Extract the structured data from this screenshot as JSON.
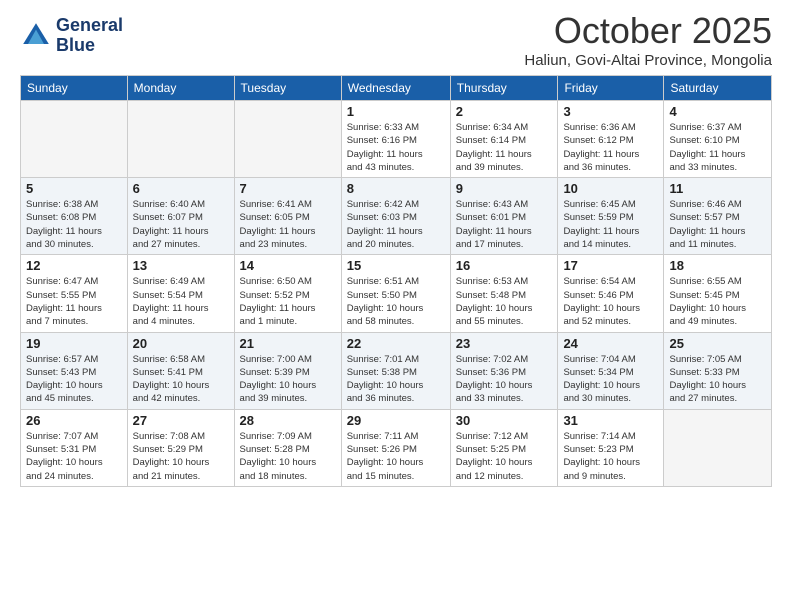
{
  "header": {
    "logo_line1": "General",
    "logo_line2": "Blue",
    "month": "October 2025",
    "location": "Haliun, Govi-Altai Province, Mongolia"
  },
  "weekdays": [
    "Sunday",
    "Monday",
    "Tuesday",
    "Wednesday",
    "Thursday",
    "Friday",
    "Saturday"
  ],
  "weeks": [
    [
      {
        "day": null,
        "info": null
      },
      {
        "day": null,
        "info": null
      },
      {
        "day": null,
        "info": null
      },
      {
        "day": "1",
        "info": "Sunrise: 6:33 AM\nSunset: 6:16 PM\nDaylight: 11 hours\nand 43 minutes."
      },
      {
        "day": "2",
        "info": "Sunrise: 6:34 AM\nSunset: 6:14 PM\nDaylight: 11 hours\nand 39 minutes."
      },
      {
        "day": "3",
        "info": "Sunrise: 6:36 AM\nSunset: 6:12 PM\nDaylight: 11 hours\nand 36 minutes."
      },
      {
        "day": "4",
        "info": "Sunrise: 6:37 AM\nSunset: 6:10 PM\nDaylight: 11 hours\nand 33 minutes."
      }
    ],
    [
      {
        "day": "5",
        "info": "Sunrise: 6:38 AM\nSunset: 6:08 PM\nDaylight: 11 hours\nand 30 minutes."
      },
      {
        "day": "6",
        "info": "Sunrise: 6:40 AM\nSunset: 6:07 PM\nDaylight: 11 hours\nand 27 minutes."
      },
      {
        "day": "7",
        "info": "Sunrise: 6:41 AM\nSunset: 6:05 PM\nDaylight: 11 hours\nand 23 minutes."
      },
      {
        "day": "8",
        "info": "Sunrise: 6:42 AM\nSunset: 6:03 PM\nDaylight: 11 hours\nand 20 minutes."
      },
      {
        "day": "9",
        "info": "Sunrise: 6:43 AM\nSunset: 6:01 PM\nDaylight: 11 hours\nand 17 minutes."
      },
      {
        "day": "10",
        "info": "Sunrise: 6:45 AM\nSunset: 5:59 PM\nDaylight: 11 hours\nand 14 minutes."
      },
      {
        "day": "11",
        "info": "Sunrise: 6:46 AM\nSunset: 5:57 PM\nDaylight: 11 hours\nand 11 minutes."
      }
    ],
    [
      {
        "day": "12",
        "info": "Sunrise: 6:47 AM\nSunset: 5:55 PM\nDaylight: 11 hours\nand 7 minutes."
      },
      {
        "day": "13",
        "info": "Sunrise: 6:49 AM\nSunset: 5:54 PM\nDaylight: 11 hours\nand 4 minutes."
      },
      {
        "day": "14",
        "info": "Sunrise: 6:50 AM\nSunset: 5:52 PM\nDaylight: 11 hours\nand 1 minute."
      },
      {
        "day": "15",
        "info": "Sunrise: 6:51 AM\nSunset: 5:50 PM\nDaylight: 10 hours\nand 58 minutes."
      },
      {
        "day": "16",
        "info": "Sunrise: 6:53 AM\nSunset: 5:48 PM\nDaylight: 10 hours\nand 55 minutes."
      },
      {
        "day": "17",
        "info": "Sunrise: 6:54 AM\nSunset: 5:46 PM\nDaylight: 10 hours\nand 52 minutes."
      },
      {
        "day": "18",
        "info": "Sunrise: 6:55 AM\nSunset: 5:45 PM\nDaylight: 10 hours\nand 49 minutes."
      }
    ],
    [
      {
        "day": "19",
        "info": "Sunrise: 6:57 AM\nSunset: 5:43 PM\nDaylight: 10 hours\nand 45 minutes."
      },
      {
        "day": "20",
        "info": "Sunrise: 6:58 AM\nSunset: 5:41 PM\nDaylight: 10 hours\nand 42 minutes."
      },
      {
        "day": "21",
        "info": "Sunrise: 7:00 AM\nSunset: 5:39 PM\nDaylight: 10 hours\nand 39 minutes."
      },
      {
        "day": "22",
        "info": "Sunrise: 7:01 AM\nSunset: 5:38 PM\nDaylight: 10 hours\nand 36 minutes."
      },
      {
        "day": "23",
        "info": "Sunrise: 7:02 AM\nSunset: 5:36 PM\nDaylight: 10 hours\nand 33 minutes."
      },
      {
        "day": "24",
        "info": "Sunrise: 7:04 AM\nSunset: 5:34 PM\nDaylight: 10 hours\nand 30 minutes."
      },
      {
        "day": "25",
        "info": "Sunrise: 7:05 AM\nSunset: 5:33 PM\nDaylight: 10 hours\nand 27 minutes."
      }
    ],
    [
      {
        "day": "26",
        "info": "Sunrise: 7:07 AM\nSunset: 5:31 PM\nDaylight: 10 hours\nand 24 minutes."
      },
      {
        "day": "27",
        "info": "Sunrise: 7:08 AM\nSunset: 5:29 PM\nDaylight: 10 hours\nand 21 minutes."
      },
      {
        "day": "28",
        "info": "Sunrise: 7:09 AM\nSunset: 5:28 PM\nDaylight: 10 hours\nand 18 minutes."
      },
      {
        "day": "29",
        "info": "Sunrise: 7:11 AM\nSunset: 5:26 PM\nDaylight: 10 hours\nand 15 minutes."
      },
      {
        "day": "30",
        "info": "Sunrise: 7:12 AM\nSunset: 5:25 PM\nDaylight: 10 hours\nand 12 minutes."
      },
      {
        "day": "31",
        "info": "Sunrise: 7:14 AM\nSunset: 5:23 PM\nDaylight: 10 hours\nand 9 minutes."
      },
      {
        "day": null,
        "info": null
      }
    ]
  ]
}
